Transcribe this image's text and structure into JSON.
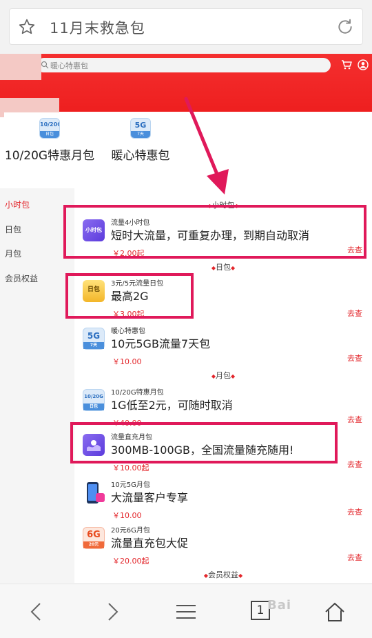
{
  "browser": {
    "url_text": "11月末救急包"
  },
  "header": {
    "search_placeholder": "暖心特惠包"
  },
  "categories": [
    {
      "icon_top": "10/20G",
      "icon_bottom": "日包",
      "label": "10/20G特惠月包"
    },
    {
      "icon_top": "5G",
      "icon_bottom": "7天",
      "label": "暖心特惠包"
    }
  ],
  "sidebar": {
    "items": [
      {
        "label": "小时包",
        "active": true
      },
      {
        "label": "日包",
        "active": false
      },
      {
        "label": "月包",
        "active": false
      },
      {
        "label": "会员权益",
        "active": false
      }
    ]
  },
  "sections": {
    "hour": "小时包",
    "day": "日包",
    "month": "月包",
    "member": "会员权益"
  },
  "products": [
    {
      "icon": "hour-pack-icon",
      "icon_text": "小时包",
      "name": "流量4小时包",
      "desc": "短时大流量，可重复办理，到期自动取消",
      "price": "￥2.00起",
      "action": "去查"
    },
    {
      "icon": "day-pack-icon",
      "icon_text": "日包",
      "name": "3元/5元流量日包",
      "desc": "最高2G",
      "price": "￥3.00起",
      "action": "去查"
    },
    {
      "icon": "5g-7day-icon",
      "icon_text": "5G",
      "icon_sub": "7天",
      "name": "暖心特惠包",
      "desc": "10元5GB流量7天包",
      "price": "￥10.00",
      "action": "去查"
    },
    {
      "icon": "10-20g-month-icon",
      "icon_text": "10/20G",
      "icon_sub": "日包",
      "name": "10/20G特惠月包",
      "desc": "1G低至2元，可随时取消",
      "price": "￥40.00",
      "action": "去查"
    },
    {
      "icon": "direct-charge-icon",
      "icon_text": "",
      "name": "流量直充月包",
      "desc": "300MB-100GB，全国流量随充随用!",
      "price": "￥10.00起",
      "action": "去查"
    },
    {
      "icon": "phone-5g-icon",
      "icon_text": "",
      "name": "10元5G月包",
      "desc": "大流量客户专享",
      "price": "￥10.00",
      "action": "去查"
    },
    {
      "icon": "6g-20yuan-icon",
      "icon_text": "6G",
      "icon_sub": "20元",
      "name": "20元6G月包",
      "desc": "流量直充包大促",
      "price": "￥20.00起",
      "action": "去查"
    }
  ],
  "bottom_bar": {
    "tab_count": "1",
    "watermark": "Bai"
  },
  "colors": {
    "brand_red": "#ee1f1f",
    "price_red": "#e3262b",
    "annotation": "#e0195a"
  }
}
